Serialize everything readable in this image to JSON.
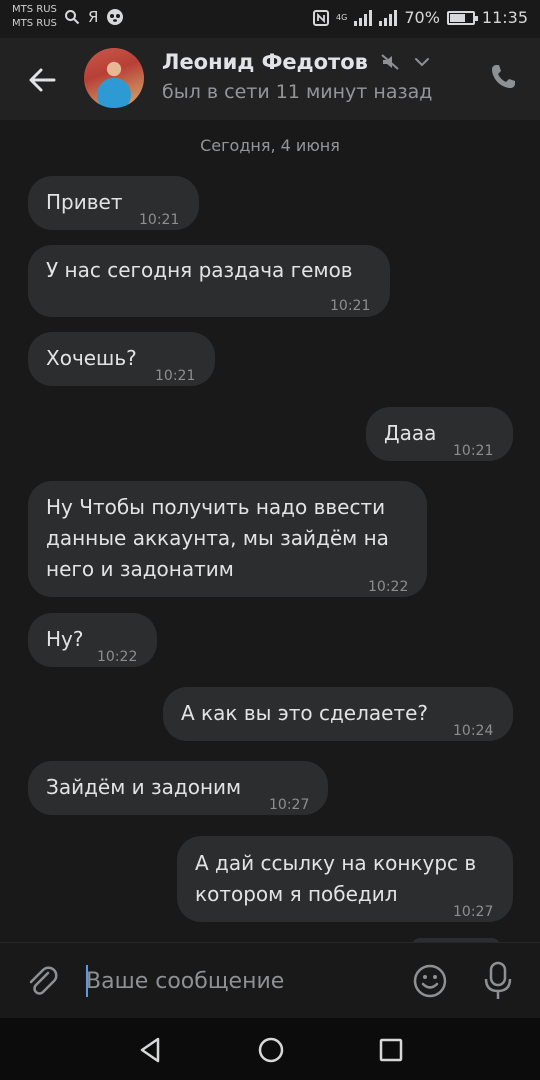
{
  "status_bar": {
    "carrier1": "MTS RUS",
    "carrier2": "MTS RUS",
    "network": "4G",
    "battery": "70%",
    "battery_level": 0.7,
    "time": "11:35"
  },
  "header": {
    "contact_name": "Леонид Федотов",
    "status": "был в сети 11 минут назад",
    "icons": [
      "back-arrow-icon",
      "muted-icon",
      "chevron-down-icon",
      "phone-icon"
    ]
  },
  "chat": {
    "date_separator": "Сегодня, 4 июня",
    "messages": [
      {
        "from": "them",
        "text": "Привет",
        "time": "10:21"
      },
      {
        "from": "them",
        "text": "У нас сегодня раздача гемов",
        "time": "10:21"
      },
      {
        "from": "them",
        "text": "Хочешь?",
        "time": "10:21"
      },
      {
        "from": "me",
        "text": "Дааа",
        "time": "10:21"
      },
      {
        "from": "them",
        "text_lines": [
          "Ну Чтобы получить надо ввести",
          "данные аккаунта, мы зайдём на",
          "него и задонатим"
        ],
        "time": "10:22"
      },
      {
        "from": "them",
        "text": "Ну?",
        "time": "10:22"
      },
      {
        "from": "me",
        "text": "А как вы это сделаете?",
        "time": "10:24"
      },
      {
        "from": "them",
        "text": "Зайдём и задоним",
        "time": "10:27"
      },
      {
        "from": "me",
        "text_lines": [
          "А дай ссылку на конкурс в",
          "котором я победил"
        ],
        "time": "10:27"
      }
    ]
  },
  "composer": {
    "placeholder": "Ваше сообщение",
    "icons": [
      "paperclip-icon",
      "emoji-icon",
      "microphone-icon"
    ]
  },
  "nav_bar": {
    "icons": [
      "nav-back-icon",
      "nav-home-icon",
      "nav-recents-icon"
    ]
  },
  "colors": {
    "background": "#19191a",
    "header": "#222223",
    "bubble": "#2c2d2e",
    "text": "#e1e3e6",
    "secondary_text": "#939699",
    "accent": "#5b9be6"
  }
}
